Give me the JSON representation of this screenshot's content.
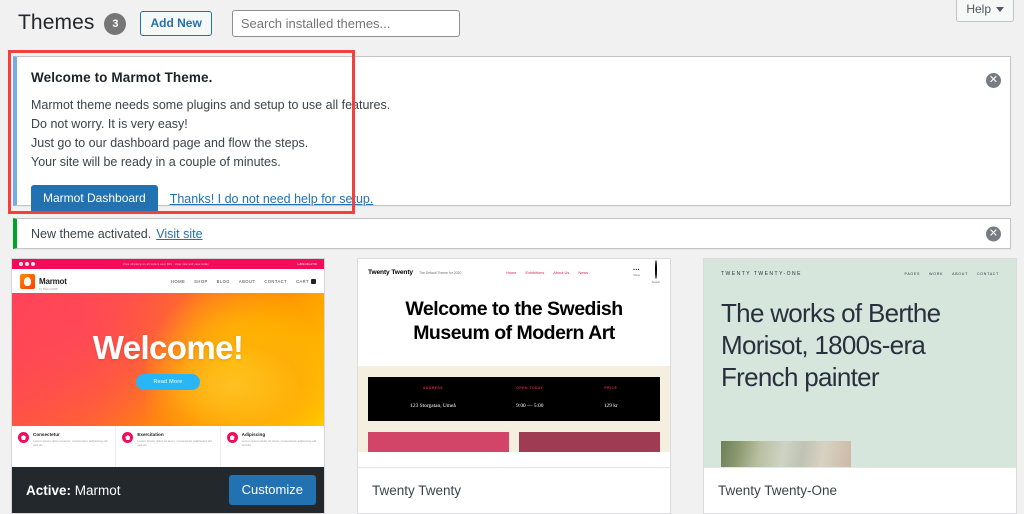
{
  "header": {
    "title": "Themes",
    "theme_count": "3",
    "add_new_label": "Add New",
    "search_placeholder": "Search installed themes...",
    "search_value": "",
    "help_label": "Help"
  },
  "notices": {
    "welcome": {
      "title": "Welcome to Marmot Theme.",
      "lines": [
        "Marmot theme needs some plugins and setup to use all features.",
        "Do not worry. It is very easy!",
        "Just go to our dashboard page and flow the steps.",
        "Your site will be ready in a couple of minutes."
      ],
      "primary_button": "Marmot Dashboard",
      "dismiss_link": "Thanks! I do not need help for setup.",
      "dismiss_icon": "close-circle-icon",
      "accent_color": "#72aee6"
    },
    "activated": {
      "text": "New theme activated.",
      "link": "Visit site",
      "dismiss_icon": "close-circle-icon",
      "accent_color": "#00a32a"
    }
  },
  "annotation": {
    "color": "#f4403a"
  },
  "themes": [
    {
      "name": "Marmot",
      "active": true,
      "active_prefix": "Active:",
      "customize_label": "Customize",
      "screenshot": {
        "topbar_promo": "Free shipping on all orders over $50 - shop now and save today",
        "topbar_phone": "1-800-431-2700",
        "logo_name": "Marmot",
        "logo_sub": "by MarmotWP",
        "menu": [
          "HOME",
          "SHOP",
          "BLOG",
          "ABOUT",
          "CONTACT"
        ],
        "cart_label": "CART",
        "hero_title": "Welcome!",
        "hero_button": "Read More",
        "features": [
          {
            "title": "Consectetur",
            "text": "Lorem ipsum dolor sit amet, consectetur adipiscing elit sed do"
          },
          {
            "title": "Exercitation",
            "text": "Lorem ipsum dolor sit amet, consectetur adipiscing elit sed do"
          },
          {
            "title": "Adipiscing",
            "text": "Lorem ipsum dolor sit amet, consectetur adipiscing elit sed do"
          }
        ]
      }
    },
    {
      "name": "Twenty Twenty",
      "active": false,
      "screenshot": {
        "brand": "Twenty Twenty",
        "tagline": "The Default Theme for 2020",
        "menu": [
          "Home",
          "Exhibitions",
          "About Us",
          "News"
        ],
        "menu_icon_label": "Menu",
        "search_icon_label": "Search",
        "hero_title_line1": "Welcome to the Swedish",
        "hero_title_line2": "Museum of Modern Art",
        "info": [
          {
            "label": "ADDRESS",
            "value": "123 Storgatan, Umeå"
          },
          {
            "label": "OPEN TODAY",
            "value": "9:00 — 5:00"
          },
          {
            "label": "PRICE",
            "value": "129 kr"
          }
        ]
      }
    },
    {
      "name": "Twenty Twenty-One",
      "active": false,
      "screenshot": {
        "brand": "TWENTY TWENTY-ONE",
        "menu": [
          "PAGES",
          "WORK",
          "ABOUT",
          "CONTACT"
        ],
        "title_line1": "The works of Berthe",
        "title_line2": "Morisot, 1800s-era",
        "title_line3": "French painter"
      }
    }
  ]
}
